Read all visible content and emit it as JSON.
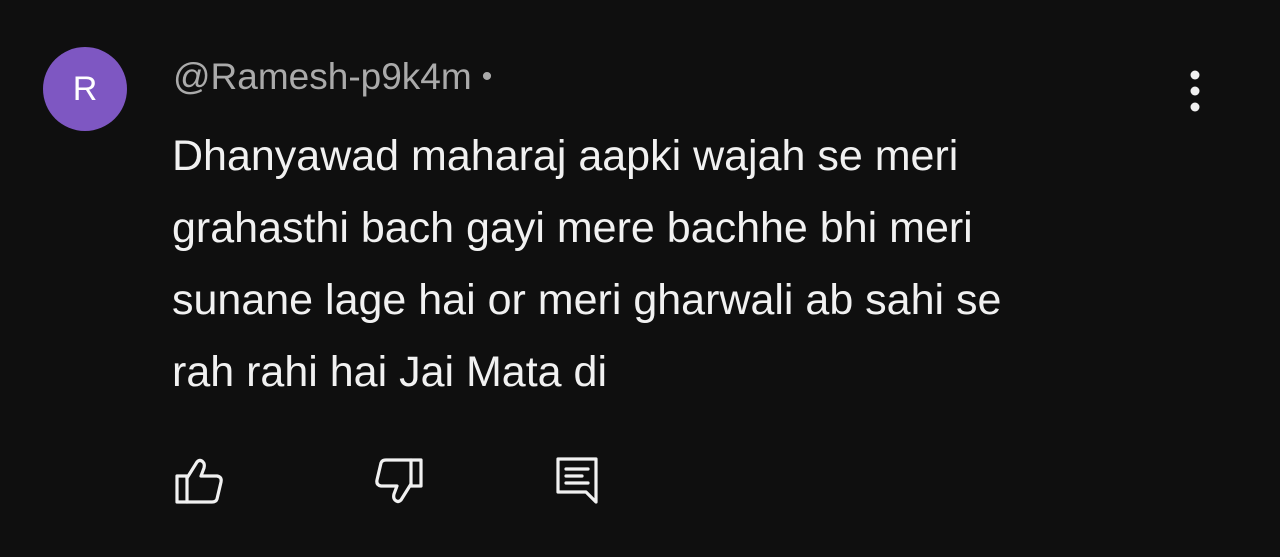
{
  "comment": {
    "avatar_letter": "R",
    "avatar_color": "#7e57c2",
    "author": "@Ramesh-p9k4m",
    "separator": "•",
    "text_lines": [
      "Dhanyawad maharaj aapki wajah se meri",
      "grahasthi bach gayi mere bachhe bhi meri",
      "sunane lage hai or meri gharwali ab sahi se",
      "rah rahi hai Jai Mata di"
    ]
  },
  "actions": {
    "like_icon": "thumbs-up-icon",
    "dislike_icon": "thumbs-down-icon",
    "reply_icon": "reply-comment-icon",
    "more_icon": "more-vertical-icon"
  },
  "colors": {
    "background": "#0f0f0f",
    "text": "#f1f1f1",
    "secondary_text": "#aaaaaa"
  }
}
